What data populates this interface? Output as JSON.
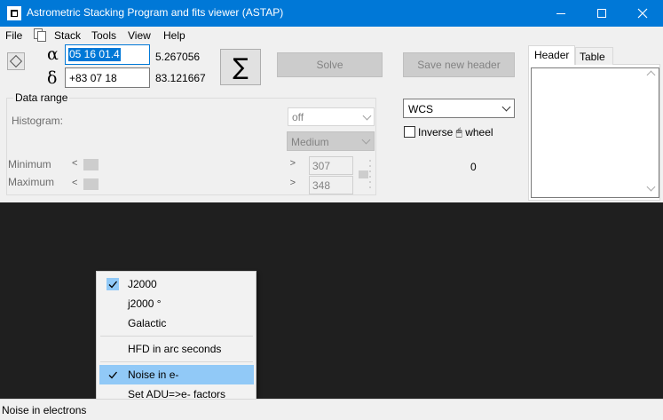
{
  "window": {
    "title": "Astrometric Stacking Program and fits viewer (ASTAP)"
  },
  "menu": {
    "file": "File",
    "stack": "Stack",
    "tools": "Tools",
    "view": "View",
    "help": "Help"
  },
  "coords": {
    "alpha_symbol": "α",
    "delta_symbol": "δ",
    "ra_text": "05 16 01.4",
    "dec_text": "+83 07 18",
    "ra_decimal": "5.267056",
    "dec_decimal": "83.121667"
  },
  "buttons": {
    "stack_symbol": "∑",
    "solve": "Solve",
    "save_new_header": "Save new header"
  },
  "data_range": {
    "group_label": "Data range",
    "histogram_label": "Histogram:",
    "histogram_value": "off",
    "quality_value": "Medium",
    "minimum_label": "Minimum",
    "maximum_label": "Maximum",
    "minimum_value": "307",
    "maximum_value": "348"
  },
  "wcs": {
    "selected": "WCS",
    "inverse_wheel_label": "Inverse 🖱 wheel",
    "inverse_checked": false,
    "counter": "0"
  },
  "tabs": {
    "header": "Header",
    "table": "Table"
  },
  "context_menu": {
    "items": [
      {
        "label": "J2000",
        "checked": true
      },
      {
        "label": "j2000 °",
        "checked": false
      },
      {
        "label": "Galactic",
        "checked": false
      },
      {
        "label": "HFD in arc seconds",
        "checked": false
      },
      {
        "label": "Noise in e-",
        "checked": true
      },
      {
        "label": "Set ADU=>e- factors",
        "checked": false
      }
    ]
  },
  "status": {
    "text": "Noise in electrons"
  },
  "colors": {
    "titlebar": "#0078d7",
    "image_background": "#1f1f1f",
    "menu_highlight": "#91c9f7"
  }
}
